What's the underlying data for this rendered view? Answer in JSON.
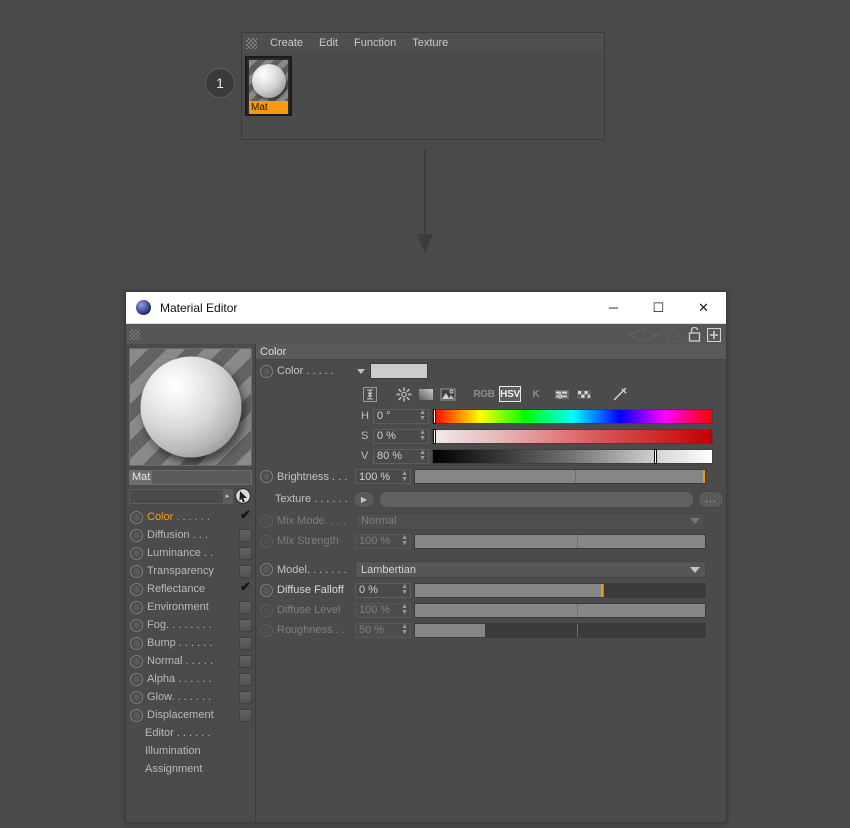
{
  "step_badge": {
    "number": "1"
  },
  "material_manager": {
    "menus": [
      "Create",
      "Edit",
      "Function",
      "Texture"
    ],
    "material": {
      "name": "Mat"
    }
  },
  "material_editor": {
    "title": "Material Editor",
    "window_buttons": {
      "minimize": "─",
      "maximize": "☐",
      "close": "✕"
    },
    "toolbar_icons": [
      "lock-icon",
      "add-icon"
    ],
    "left_panel": {
      "material_name": "Mat",
      "search_placeholder": "",
      "channels": [
        {
          "label": "Color . . . . . .",
          "checked": true,
          "active": true,
          "has_radio": true
        },
        {
          "label": "Diffusion . . .",
          "checked": false,
          "active": false,
          "has_radio": true
        },
        {
          "label": "Luminance . .",
          "checked": false,
          "active": false,
          "has_radio": true
        },
        {
          "label": "Transparency",
          "checked": false,
          "active": false,
          "has_radio": true
        },
        {
          "label": "Reflectance",
          "checked": true,
          "active": false,
          "has_radio": true
        },
        {
          "label": "Environment",
          "checked": false,
          "active": false,
          "has_radio": true
        },
        {
          "label": "Fog. . . . . . . .",
          "checked": false,
          "active": false,
          "has_radio": true
        },
        {
          "label": "Bump . . . . . .",
          "checked": false,
          "active": false,
          "has_radio": true
        },
        {
          "label": "Normal . . . . .",
          "checked": false,
          "active": false,
          "has_radio": true
        },
        {
          "label": "Alpha . . . . . .",
          "checked": false,
          "active": false,
          "has_radio": true
        },
        {
          "label": "Glow. . . . . . .",
          "checked": false,
          "active": false,
          "has_radio": true
        },
        {
          "label": "Displacement",
          "checked": false,
          "active": false,
          "has_radio": true
        },
        {
          "label": "Editor . . . . . .",
          "checked": false,
          "active": false,
          "has_radio": false
        },
        {
          "label": "Illumination",
          "checked": false,
          "active": false,
          "has_radio": false
        },
        {
          "label": "Assignment",
          "checked": false,
          "active": false,
          "has_radio": false
        }
      ]
    },
    "color_panel": {
      "section_title": "Color",
      "color_row": {
        "label": "Color . . . . .",
        "swatch_hex": "#cccccc"
      },
      "color_mode_buttons": [
        "RGB",
        "HSV",
        "K"
      ],
      "selected_color_mode": "HSV",
      "hsv": [
        {
          "label": "H",
          "value": "0 °",
          "percent": 0
        },
        {
          "label": "S",
          "value": "0 %",
          "percent": 0
        },
        {
          "label": "V",
          "value": "80 %",
          "percent": 80
        }
      ],
      "brightness": {
        "label": "Brightness . . .",
        "value": "100 %",
        "percent": 100
      },
      "texture": {
        "label": "Texture . . . . . .",
        "value": "",
        "browse_label": "..."
      },
      "mix_mode": {
        "label": "Mix Mode. . . .",
        "value": "Normal"
      },
      "mix_strength": {
        "label": "Mix Strength",
        "value": "100 %",
        "percent": 100
      },
      "model": {
        "label": "Model. . . . . . .",
        "value": "Lambertian"
      },
      "diffuse_falloff": {
        "label": "Diffuse Falloff",
        "value": "0 %",
        "percent": 65
      },
      "diffuse_level": {
        "label": "Diffuse Level",
        "value": "100 %",
        "percent": 100
      },
      "roughness": {
        "label": "Roughness . .",
        "value": "50 %",
        "percent": 24
      }
    }
  }
}
